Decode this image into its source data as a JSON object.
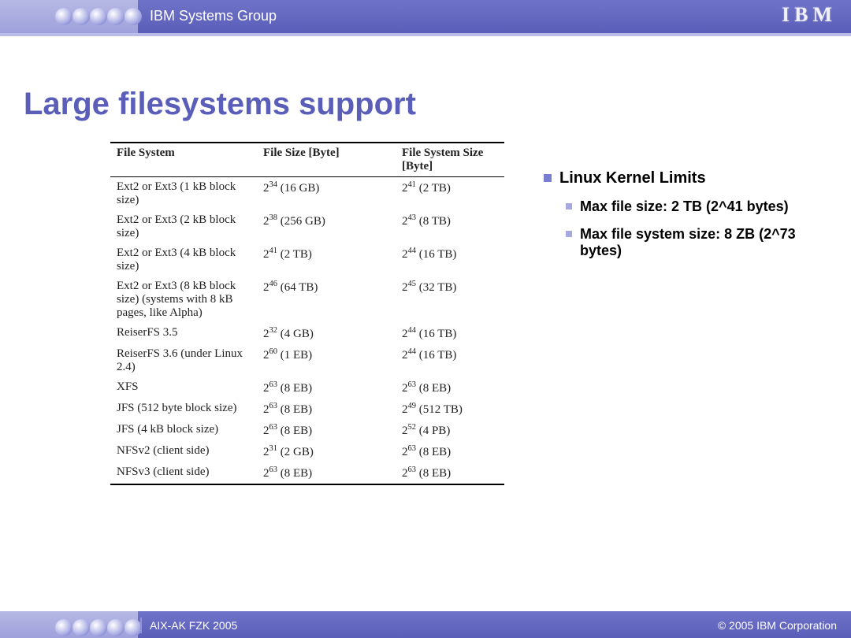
{
  "header": {
    "group": "IBM Systems Group",
    "logo": "IBM"
  },
  "footer": {
    "left": "AIX-AK FZK 2005",
    "right": "© 2005 IBM Corporation"
  },
  "title": "Large filesystems support",
  "table": {
    "headers": [
      "File System",
      "File Size [Byte]",
      "File System Size [Byte]"
    ],
    "rows": [
      {
        "fs": "Ext2 or Ext3 (1 kB block size)",
        "size_exp": "34",
        "size_h": "(16 GB)",
        "fss_exp": "41",
        "fss_h": "(2 TB)"
      },
      {
        "fs": "Ext2 or Ext3 (2 kB block size)",
        "size_exp": "38",
        "size_h": "(256 GB)",
        "fss_exp": "43",
        "fss_h": "(8 TB)"
      },
      {
        "fs": "Ext2 or Ext3 (4 kB block size)",
        "size_exp": "41",
        "size_h": "(2 TB)",
        "fss_exp": "44",
        "fss_h": "(16 TB)"
      },
      {
        "fs": "Ext2 or Ext3 (8 kB block size) (systems with 8 kB pages, like Alpha)",
        "size_exp": "46",
        "size_h": "(64 TB)",
        "fss_exp": "45",
        "fss_h": "(32 TB)"
      },
      {
        "fs": "ReiserFS 3.5",
        "size_exp": "32",
        "size_h": "(4 GB)",
        "fss_exp": "44",
        "fss_h": "(16 TB)"
      },
      {
        "fs": "ReiserFS 3.6 (under Linux 2.4)",
        "size_exp": "60",
        "size_h": "(1 EB)",
        "fss_exp": "44",
        "fss_h": "(16 TB)"
      },
      {
        "fs": "XFS",
        "size_exp": "63",
        "size_h": "(8 EB)",
        "fss_exp": "63",
        "fss_h": "(8 EB)"
      },
      {
        "fs": "JFS (512 byte block size)",
        "size_exp": "63",
        "size_h": "(8 EB)",
        "fss_exp": "49",
        "fss_h": "(512 TB)"
      },
      {
        "fs": "JFS (4 kB block size)",
        "size_exp": "63",
        "size_h": "(8 EB)",
        "fss_exp": "52",
        "fss_h": "(4 PB)"
      },
      {
        "fs": "NFSv2 (client side)",
        "size_exp": "31",
        "size_h": "(2 GB)",
        "fss_exp": "63",
        "fss_h": "(8 EB)"
      },
      {
        "fs": "NFSv3 (client side)",
        "size_exp": "63",
        "size_h": "(8 EB)",
        "fss_exp": "63",
        "fss_h": "(8 EB)"
      }
    ]
  },
  "bullets": {
    "h": "Linux Kernel Limits",
    "items": [
      "Max file size: 2 TB (2^41 bytes)",
      "Max file system size: 8 ZB (2^73 bytes)"
    ]
  }
}
